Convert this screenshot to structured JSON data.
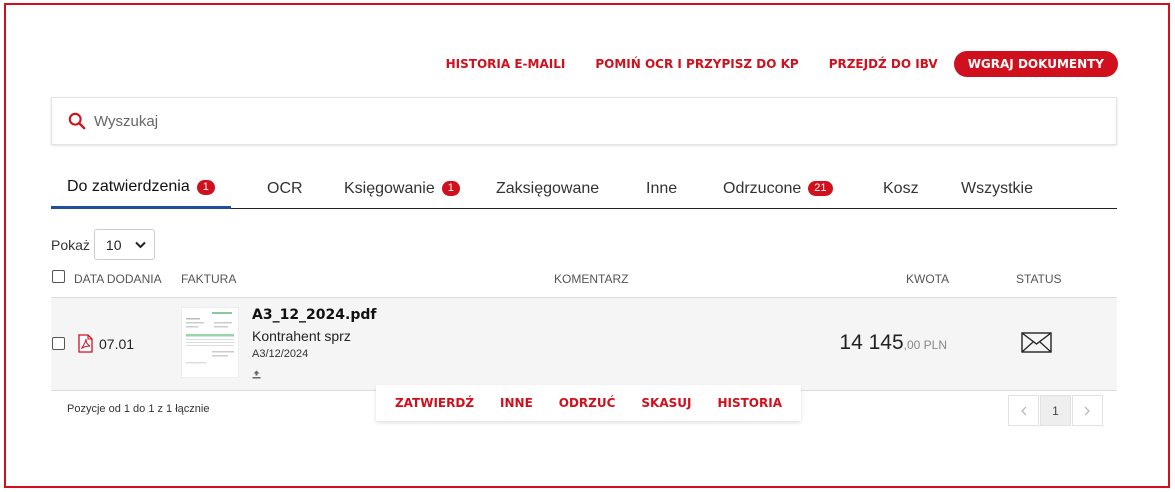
{
  "header": {
    "links": [
      "HISTORIA E-MAILI",
      "POMIŃ OCR I PRZYPISZ DO KP",
      "PRZEJDŹ DO IBV"
    ],
    "upload_button": "WGRAJ DOKUMENTY"
  },
  "search": {
    "placeholder": "Wyszukaj",
    "icon": "search-icon",
    "icon_color": "#d0101c"
  },
  "tabs": [
    {
      "label": "Do zatwierdzenia",
      "badge": "1",
      "active": true
    },
    {
      "label": "OCR"
    },
    {
      "label": "Księgowanie",
      "badge": "1"
    },
    {
      "label": "Zaksięgowane"
    },
    {
      "label": "Inne"
    },
    {
      "label": "Odrzucone",
      "badge": "21"
    },
    {
      "label": "Kosz"
    },
    {
      "label": "Wszystkie"
    }
  ],
  "page_size": {
    "label": "Pokaż",
    "value": "10"
  },
  "table": {
    "columns": [
      "DATA DODANIA",
      "FAKTURA",
      "KOMENTARZ",
      "KWOTA",
      "STATUS"
    ],
    "rows": [
      {
        "date": "07.01",
        "file_name": "A3_12_2024.pdf",
        "contractor": "Kontrahent sprz",
        "invoice_number": "A3/12/2024",
        "amount_main": "14 145",
        "amount_decimal": ",00 PLN",
        "file_icon": "pdf-icon",
        "status_icon": "envelope-icon"
      }
    ]
  },
  "footer": {
    "info": "Pozycje od 1 do 1 z 1 łącznie",
    "current_page": "1"
  },
  "actions": [
    "ZATWIERDŹ",
    "INNE",
    "ODRZUĆ",
    "SKASUJ",
    "HISTORIA"
  ],
  "colors": {
    "accent": "#d0101c",
    "active_tab_underline": "#1f4fa0"
  }
}
